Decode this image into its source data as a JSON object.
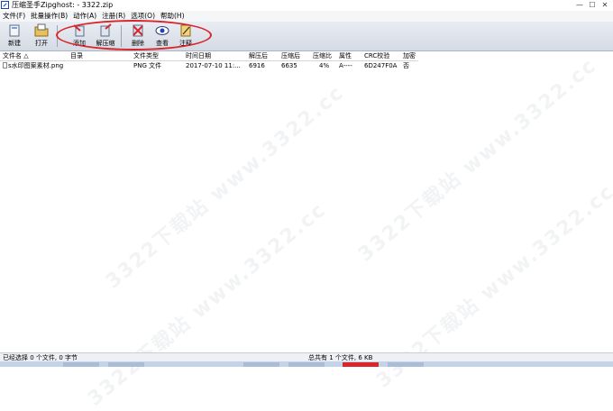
{
  "window": {
    "title": "压缩圣手Zipghost: - 3322.zip"
  },
  "menu": [
    "文件(F)",
    "批量操作(B)",
    "动作(A)",
    "注册(R)",
    "选项(O)",
    "帮助(H)"
  ],
  "toolbar": {
    "new": "新建",
    "open": "打开",
    "add": "添加",
    "extract": "解压缩",
    "delete": "删除",
    "view": "查看",
    "comment": "注释"
  },
  "columns": [
    "文件名 △",
    "目录",
    "文件类型",
    "时间日期",
    "解压后",
    "压缩后",
    "压缩比",
    "属性",
    "CRC校验",
    "加密"
  ],
  "files": [
    {
      "name": "s水印图案素材.png",
      "dir": "",
      "type": "PNG 文件",
      "date": "2017-07-10 11:...",
      "size": "6916",
      "packed": "6635",
      "ratio": "4%",
      "attr": "A----",
      "crc": "6D247F0A",
      "encrypted": "否"
    }
  ],
  "status": {
    "left": "已经选择 0 个文件, 0 字节",
    "right": "总共有 1 个文件, 6 KB"
  },
  "watermark": "3322下载站 www.3322.cc",
  "colors": {
    "highlight": "#d9252c",
    "accent": "#1c44b8"
  }
}
